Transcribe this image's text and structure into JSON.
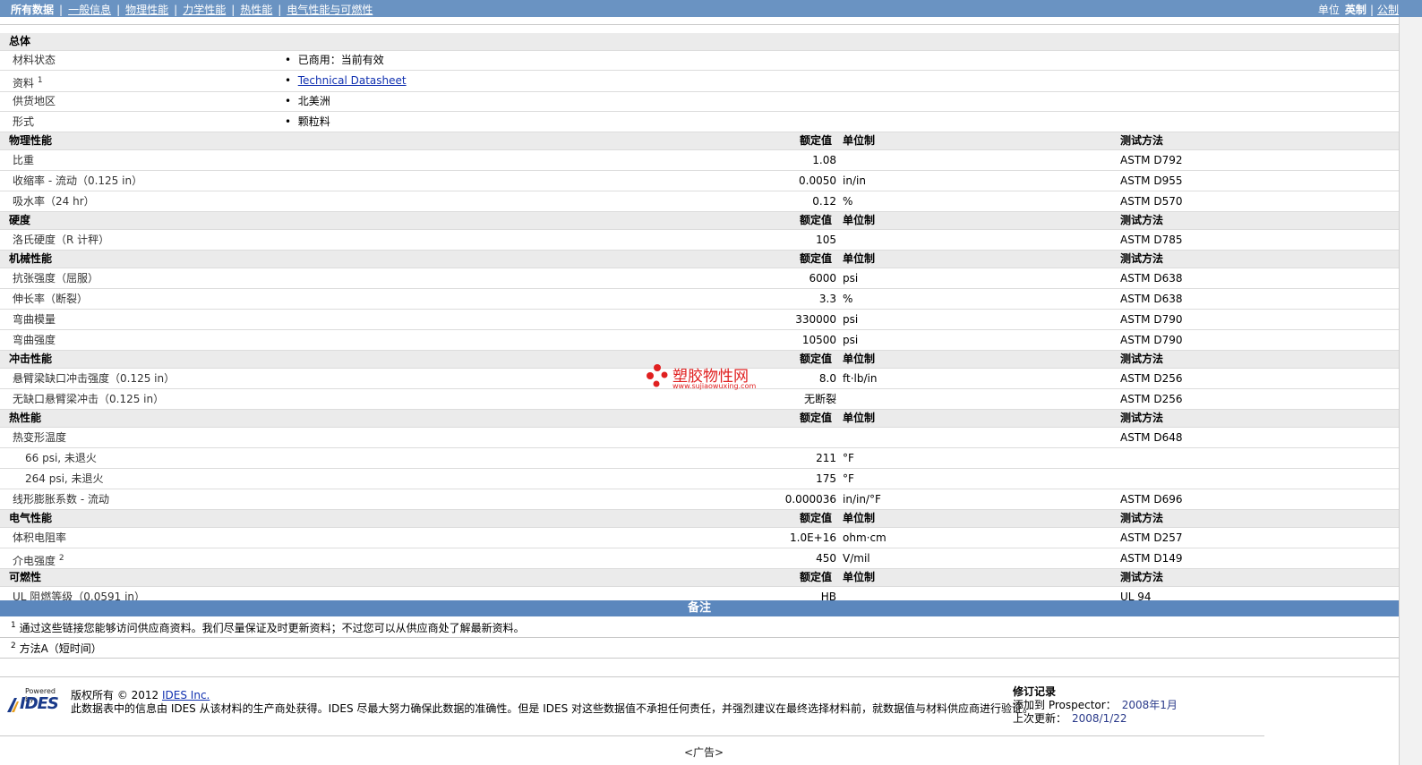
{
  "nav": {
    "tabs": [
      "所有数据",
      "一般信息",
      "物理性能",
      "力学性能",
      "热性能",
      "电气性能与可燃性"
    ],
    "units_label": "单位",
    "units_active": "英制",
    "units_alt": "公制"
  },
  "columns": {
    "value": "额定值",
    "unit": "单位制",
    "method": "测试方法"
  },
  "general": {
    "title": "总体",
    "rows": [
      {
        "label": "材料状态",
        "value": "已商用：当前有效"
      },
      {
        "label": "资料",
        "sup": "1",
        "value": "Technical Datasheet"
      },
      {
        "label": "供货地区",
        "value": "北美洲"
      },
      {
        "label": "形式",
        "value": "颗粒料"
      }
    ]
  },
  "sections": {
    "physical": {
      "title": "物理性能",
      "rows": [
        {
          "label": "比重",
          "value": "1.08",
          "unit": "",
          "method": "ASTM D792"
        },
        {
          "label": "收缩率 - 流动（0.125 in）",
          "value": "0.0050",
          "unit": "in/in",
          "method": "ASTM D955"
        },
        {
          "label": "吸水率（24 hr）",
          "value": "0.12",
          "unit": "%",
          "method": "ASTM D570"
        }
      ]
    },
    "hardness": {
      "title": "硬度",
      "rows": [
        {
          "label": "洛氏硬度（R 计秤）",
          "value": "105",
          "unit": "",
          "method": "ASTM D785"
        }
      ]
    },
    "mechanical": {
      "title": "机械性能",
      "rows": [
        {
          "label": "抗张强度（屈服）",
          "value": "6000",
          "unit": "psi",
          "method": "ASTM D638"
        },
        {
          "label": "伸长率（断裂）",
          "value": "3.3",
          "unit": "%",
          "method": "ASTM D638"
        },
        {
          "label": "弯曲模量",
          "value": "330000",
          "unit": "psi",
          "method": "ASTM D790"
        },
        {
          "label": "弯曲强度",
          "value": "10500",
          "unit": "psi",
          "method": "ASTM D790"
        }
      ]
    },
    "impact": {
      "title": "冲击性能",
      "rows": [
        {
          "label": "悬臂梁缺口冲击强度（0.125 in）",
          "value": "8.0",
          "unit": "ft·lb/in",
          "method": "ASTM D256"
        },
        {
          "label": "无缺口悬臂梁冲击（0.125 in）",
          "value": "无断裂",
          "unit": "",
          "method": "ASTM D256"
        }
      ]
    },
    "thermal": {
      "title": "热性能",
      "rows": [
        {
          "label": "热变形温度",
          "value": "",
          "unit": "",
          "method": "ASTM D648"
        },
        {
          "label": "66 psi, 未退火",
          "value": "211",
          "unit": "°F",
          "method": ""
        },
        {
          "label": "264 psi, 未退火",
          "value": "175",
          "unit": "°F",
          "method": ""
        },
        {
          "label": "线形膨胀系数 - 流动",
          "value": "0.000036",
          "unit": "in/in/°F",
          "method": "ASTM D696"
        }
      ]
    },
    "electrical": {
      "title": "电气性能",
      "rows": [
        {
          "label": "体积电阻率",
          "value": "1.0E+16",
          "unit": "ohm·cm",
          "method": "ASTM D257"
        },
        {
          "label": "介电强度",
          "sup": "2",
          "value": "450",
          "unit": "V/mil",
          "method": "ASTM D149"
        }
      ]
    },
    "flammability": {
      "title": "可燃性",
      "rows": [
        {
          "label": "UL 阻燃等级（0.0591 in）",
          "value": "HB",
          "unit": "",
          "method": "UL 94"
        }
      ]
    }
  },
  "notes": {
    "title": "备注",
    "items": [
      {
        "num": "1",
        "text": "通过这些链接您能够访问供应商资料。我们尽量保证及时更新资料；不过您可以从供应商处了解最新资料。"
      },
      {
        "num": "2",
        "text": "方法A（短时间）"
      }
    ]
  },
  "footer": {
    "powered_by": "Powered by",
    "logo_text": "IDES",
    "copyright": "版权所有 © 2012",
    "company_link": "IDES Inc.",
    "disclaimer": "此数据表中的信息由 IDES 从该材料的生产商处获得。IDES 尽最大努力确保此数据的准确性。但是 IDES 对这些数据值不承担任何责任，并强烈建议在最终选择材料前，就数据值与材料供应商进行验证。",
    "revision_title": "修订记录",
    "added_label": "添加到 Prospector：",
    "added_value": "2008年1月",
    "updated_label": "上次更新：",
    "updated_value": "2008/1/22",
    "ad": "<广告>"
  },
  "watermark": {
    "text": "塑胶物性网",
    "url": "www.sujiaowuxing.com",
    "color": "#e02020"
  },
  "colors": {
    "topbar": "#6a93c2",
    "notes_bar": "#5b87bd",
    "section_bg": "#ebebeb",
    "link": "#1030b0"
  }
}
